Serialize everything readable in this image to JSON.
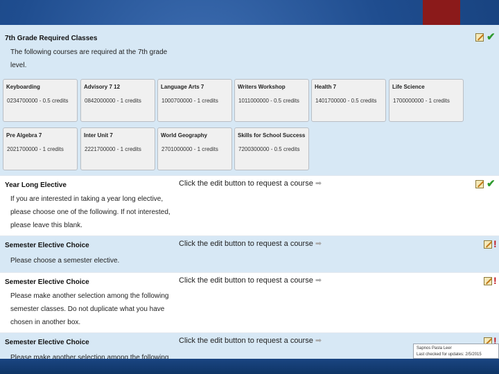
{
  "required_section": {
    "title": "7th Grade Required Classes",
    "description_lines": [
      "The following courses are required at the 7th grade",
      "level."
    ],
    "courses": [
      {
        "name": "Keyboarding",
        "code": "0234700000 - 0.5 credits"
      },
      {
        "name": "Advisory 7 12",
        "code": "0842000000 - 1 credits"
      },
      {
        "name": "Language Arts 7",
        "code": "1000700000 - 1 credits"
      },
      {
        "name": "Writers Workshop",
        "code": "1011000000 - 0.5 credits"
      },
      {
        "name": "Health 7",
        "code": "1401700000 - 0.5 credits"
      },
      {
        "name": "Life Science",
        "code": "1700000000 - 1 credits"
      },
      {
        "name": "Pre Algebra 7",
        "code": "2021700000 - 1 credits"
      },
      {
        "name": "Inter Unit 7",
        "code": "2221700000 - 1 credits"
      },
      {
        "name": "World Geography",
        "code": "2701000000 - 1 credits"
      },
      {
        "name": "Skills for School Success",
        "code": "7200300000 - 0.5 credits"
      }
    ]
  },
  "sections": [
    {
      "title": "Year Long Elective",
      "description_lines": [
        "If you are interested in taking a year long elective,",
        "please choose one of the following. If not interested,",
        "please leave this blank."
      ],
      "prompt": "Click the edit button to request a course",
      "status": "complete"
    },
    {
      "title": "Semester Elective Choice",
      "description_lines": [
        "Please choose a semester elective."
      ],
      "prompt": "Click the edit button to request a course",
      "status": "required"
    },
    {
      "title": "Semester Elective Choice",
      "description_lines": [
        "Please make another selection among the following",
        "semester classes. Do not duplicate what you have",
        "chosen in another box."
      ],
      "prompt": "Click the edit button to request a course",
      "status": "required"
    },
    {
      "title": "Semester Elective Choice",
      "description_lines": [
        "Please make another selection among the following"
      ],
      "prompt": "Click the edit button to request a course",
      "status": "required"
    }
  ],
  "icons": {
    "edit": "pencil-edit-icon",
    "complete": "green-check-icon",
    "required": "red-exclamation-icon",
    "arrow": "right-arrow-icon"
  },
  "glyphs": {
    "check": "✔",
    "alert": "!",
    "arrow": "➡"
  },
  "status_box": {
    "line1": "Sapnos Pasla Leer",
    "line2": "Last checked for updates: 2/5/2015"
  },
  "colors": {
    "section_blue": "#d7e8f5",
    "check_green": "#2e9a2e",
    "alert_red": "#c0141c",
    "accent": "#8b1a1a"
  }
}
